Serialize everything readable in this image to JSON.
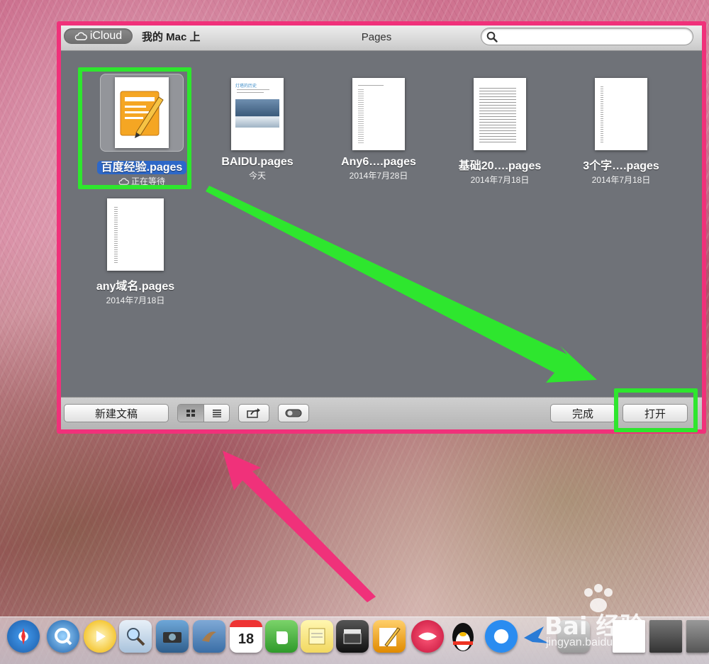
{
  "window": {
    "title": "Pages",
    "icloud_label": "iCloud",
    "mac_tab_label": "我的 Mac 上",
    "search_placeholder": ""
  },
  "documents": [
    {
      "name": "百度经验.pages",
      "date": "正在等待",
      "selected": true
    },
    {
      "name": "BAIDU.pages",
      "date": "今天"
    },
    {
      "name": "Any6….pages",
      "date": "2014年7月28日"
    },
    {
      "name": "基础20….pages",
      "date": "2014年7月18日"
    },
    {
      "name": "3个字….pages",
      "date": "2014年7月18日"
    },
    {
      "name": "any域名.pages",
      "date": "2014年7月18日"
    }
  ],
  "thumb_texts": {
    "baidu_doc_title": "灯塔的历史"
  },
  "toolbar": {
    "new_doc_label": "新建文稿",
    "done_label": "完成",
    "open_label": "打开"
  },
  "dock": {
    "calendar_day": "18"
  },
  "watermark": {
    "brand": "Bai 经验",
    "url": "jingyan.baidu.com"
  },
  "colors": {
    "pink_annotation": "#f0317a",
    "green_annotation": "#2ee62e",
    "selection_blue": "#2d68c9"
  }
}
